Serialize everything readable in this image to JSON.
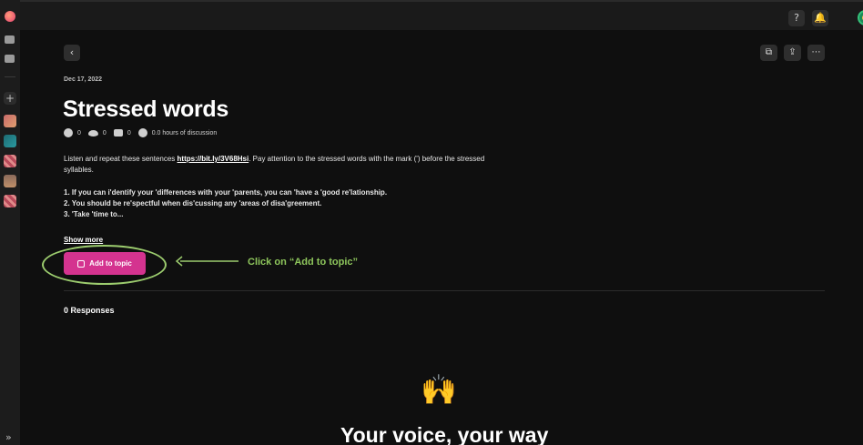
{
  "rail": {
    "icons": [
      "logo-icon",
      "camera-icon",
      "video-icon",
      "plus-icon",
      "expand-icon"
    ],
    "plus_label": "+",
    "expand_label": "»"
  },
  "topbar": {
    "help_label": "?",
    "bell_label": "🔔"
  },
  "toolbar": {
    "back_label": "‹",
    "bookmark_label": "⧉",
    "share_label": "⇪",
    "more_label": "⋯"
  },
  "post": {
    "date": "Dec 17, 2022",
    "title": "Stressed words",
    "stats": {
      "plays": "0",
      "views": "0",
      "comments": "0",
      "hours": "0.0 hours of discussion"
    },
    "description_before": "Listen and repeat these sentences ",
    "description_link": "https://bit.ly/3V68Hsi",
    "description_after": ". Pay attention to the stressed words with the mark (') before the stressed syllables.",
    "lines": [
      "1. If you can i'dentify your 'differences with your 'parents, you can 'have a 'good re'lationship.",
      "2. You should be re'spectful when dis'cussing any 'areas of disa'greement.",
      "3. 'Take 'time to..."
    ],
    "show_more": "Show more",
    "add_button": "Add to topic"
  },
  "annotation": {
    "hint": "Click on “Add to topic”",
    "highlight_color": "#9ccc6e",
    "hint_color": "#8ec65c"
  },
  "responses": {
    "label": "0 Responses",
    "emoji": "🙌",
    "heading": "Your voice, your way"
  },
  "colors": {
    "accent": "#d4338f",
    "background": "#0f0f0f"
  }
}
